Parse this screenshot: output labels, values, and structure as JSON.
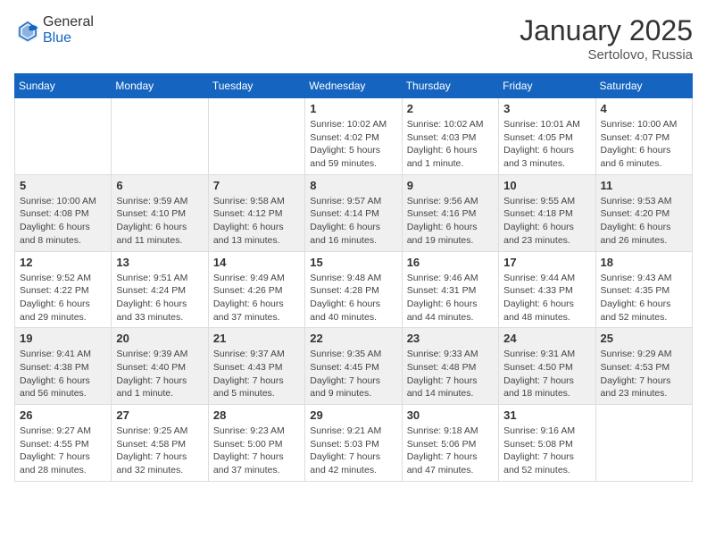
{
  "header": {
    "logo_general": "General",
    "logo_blue": "Blue",
    "month": "January 2025",
    "location": "Sertolovo, Russia"
  },
  "days_of_week": [
    "Sunday",
    "Monday",
    "Tuesday",
    "Wednesday",
    "Thursday",
    "Friday",
    "Saturday"
  ],
  "weeks": [
    [
      {
        "day": "",
        "sunrise": "",
        "sunset": "",
        "daylight": ""
      },
      {
        "day": "",
        "sunrise": "",
        "sunset": "",
        "daylight": ""
      },
      {
        "day": "",
        "sunrise": "",
        "sunset": "",
        "daylight": ""
      },
      {
        "day": "1",
        "sunrise": "Sunrise: 10:02 AM",
        "sunset": "Sunset: 4:02 PM",
        "daylight": "Daylight: 5 hours and 59 minutes."
      },
      {
        "day": "2",
        "sunrise": "Sunrise: 10:02 AM",
        "sunset": "Sunset: 4:03 PM",
        "daylight": "Daylight: 6 hours and 1 minute."
      },
      {
        "day": "3",
        "sunrise": "Sunrise: 10:01 AM",
        "sunset": "Sunset: 4:05 PM",
        "daylight": "Daylight: 6 hours and 3 minutes."
      },
      {
        "day": "4",
        "sunrise": "Sunrise: 10:00 AM",
        "sunset": "Sunset: 4:07 PM",
        "daylight": "Daylight: 6 hours and 6 minutes."
      }
    ],
    [
      {
        "day": "5",
        "sunrise": "Sunrise: 10:00 AM",
        "sunset": "Sunset: 4:08 PM",
        "daylight": "Daylight: 6 hours and 8 minutes."
      },
      {
        "day": "6",
        "sunrise": "Sunrise: 9:59 AM",
        "sunset": "Sunset: 4:10 PM",
        "daylight": "Daylight: 6 hours and 11 minutes."
      },
      {
        "day": "7",
        "sunrise": "Sunrise: 9:58 AM",
        "sunset": "Sunset: 4:12 PM",
        "daylight": "Daylight: 6 hours and 13 minutes."
      },
      {
        "day": "8",
        "sunrise": "Sunrise: 9:57 AM",
        "sunset": "Sunset: 4:14 PM",
        "daylight": "Daylight: 6 hours and 16 minutes."
      },
      {
        "day": "9",
        "sunrise": "Sunrise: 9:56 AM",
        "sunset": "Sunset: 4:16 PM",
        "daylight": "Daylight: 6 hours and 19 minutes."
      },
      {
        "day": "10",
        "sunrise": "Sunrise: 9:55 AM",
        "sunset": "Sunset: 4:18 PM",
        "daylight": "Daylight: 6 hours and 23 minutes."
      },
      {
        "day": "11",
        "sunrise": "Sunrise: 9:53 AM",
        "sunset": "Sunset: 4:20 PM",
        "daylight": "Daylight: 6 hours and 26 minutes."
      }
    ],
    [
      {
        "day": "12",
        "sunrise": "Sunrise: 9:52 AM",
        "sunset": "Sunset: 4:22 PM",
        "daylight": "Daylight: 6 hours and 29 minutes."
      },
      {
        "day": "13",
        "sunrise": "Sunrise: 9:51 AM",
        "sunset": "Sunset: 4:24 PM",
        "daylight": "Daylight: 6 hours and 33 minutes."
      },
      {
        "day": "14",
        "sunrise": "Sunrise: 9:49 AM",
        "sunset": "Sunset: 4:26 PM",
        "daylight": "Daylight: 6 hours and 37 minutes."
      },
      {
        "day": "15",
        "sunrise": "Sunrise: 9:48 AM",
        "sunset": "Sunset: 4:28 PM",
        "daylight": "Daylight: 6 hours and 40 minutes."
      },
      {
        "day": "16",
        "sunrise": "Sunrise: 9:46 AM",
        "sunset": "Sunset: 4:31 PM",
        "daylight": "Daylight: 6 hours and 44 minutes."
      },
      {
        "day": "17",
        "sunrise": "Sunrise: 9:44 AM",
        "sunset": "Sunset: 4:33 PM",
        "daylight": "Daylight: 6 hours and 48 minutes."
      },
      {
        "day": "18",
        "sunrise": "Sunrise: 9:43 AM",
        "sunset": "Sunset: 4:35 PM",
        "daylight": "Daylight: 6 hours and 52 minutes."
      }
    ],
    [
      {
        "day": "19",
        "sunrise": "Sunrise: 9:41 AM",
        "sunset": "Sunset: 4:38 PM",
        "daylight": "Daylight: 6 hours and 56 minutes."
      },
      {
        "day": "20",
        "sunrise": "Sunrise: 9:39 AM",
        "sunset": "Sunset: 4:40 PM",
        "daylight": "Daylight: 7 hours and 1 minute."
      },
      {
        "day": "21",
        "sunrise": "Sunrise: 9:37 AM",
        "sunset": "Sunset: 4:43 PM",
        "daylight": "Daylight: 7 hours and 5 minutes."
      },
      {
        "day": "22",
        "sunrise": "Sunrise: 9:35 AM",
        "sunset": "Sunset: 4:45 PM",
        "daylight": "Daylight: 7 hours and 9 minutes."
      },
      {
        "day": "23",
        "sunrise": "Sunrise: 9:33 AM",
        "sunset": "Sunset: 4:48 PM",
        "daylight": "Daylight: 7 hours and 14 minutes."
      },
      {
        "day": "24",
        "sunrise": "Sunrise: 9:31 AM",
        "sunset": "Sunset: 4:50 PM",
        "daylight": "Daylight: 7 hours and 18 minutes."
      },
      {
        "day": "25",
        "sunrise": "Sunrise: 9:29 AM",
        "sunset": "Sunset: 4:53 PM",
        "daylight": "Daylight: 7 hours and 23 minutes."
      }
    ],
    [
      {
        "day": "26",
        "sunrise": "Sunrise: 9:27 AM",
        "sunset": "Sunset: 4:55 PM",
        "daylight": "Daylight: 7 hours and 28 minutes."
      },
      {
        "day": "27",
        "sunrise": "Sunrise: 9:25 AM",
        "sunset": "Sunset: 4:58 PM",
        "daylight": "Daylight: 7 hours and 32 minutes."
      },
      {
        "day": "28",
        "sunrise": "Sunrise: 9:23 AM",
        "sunset": "Sunset: 5:00 PM",
        "daylight": "Daylight: 7 hours and 37 minutes."
      },
      {
        "day": "29",
        "sunrise": "Sunrise: 9:21 AM",
        "sunset": "Sunset: 5:03 PM",
        "daylight": "Daylight: 7 hours and 42 minutes."
      },
      {
        "day": "30",
        "sunrise": "Sunrise: 9:18 AM",
        "sunset": "Sunset: 5:06 PM",
        "daylight": "Daylight: 7 hours and 47 minutes."
      },
      {
        "day": "31",
        "sunrise": "Sunrise: 9:16 AM",
        "sunset": "Sunset: 5:08 PM",
        "daylight": "Daylight: 7 hours and 52 minutes."
      },
      {
        "day": "",
        "sunrise": "",
        "sunset": "",
        "daylight": ""
      }
    ]
  ]
}
